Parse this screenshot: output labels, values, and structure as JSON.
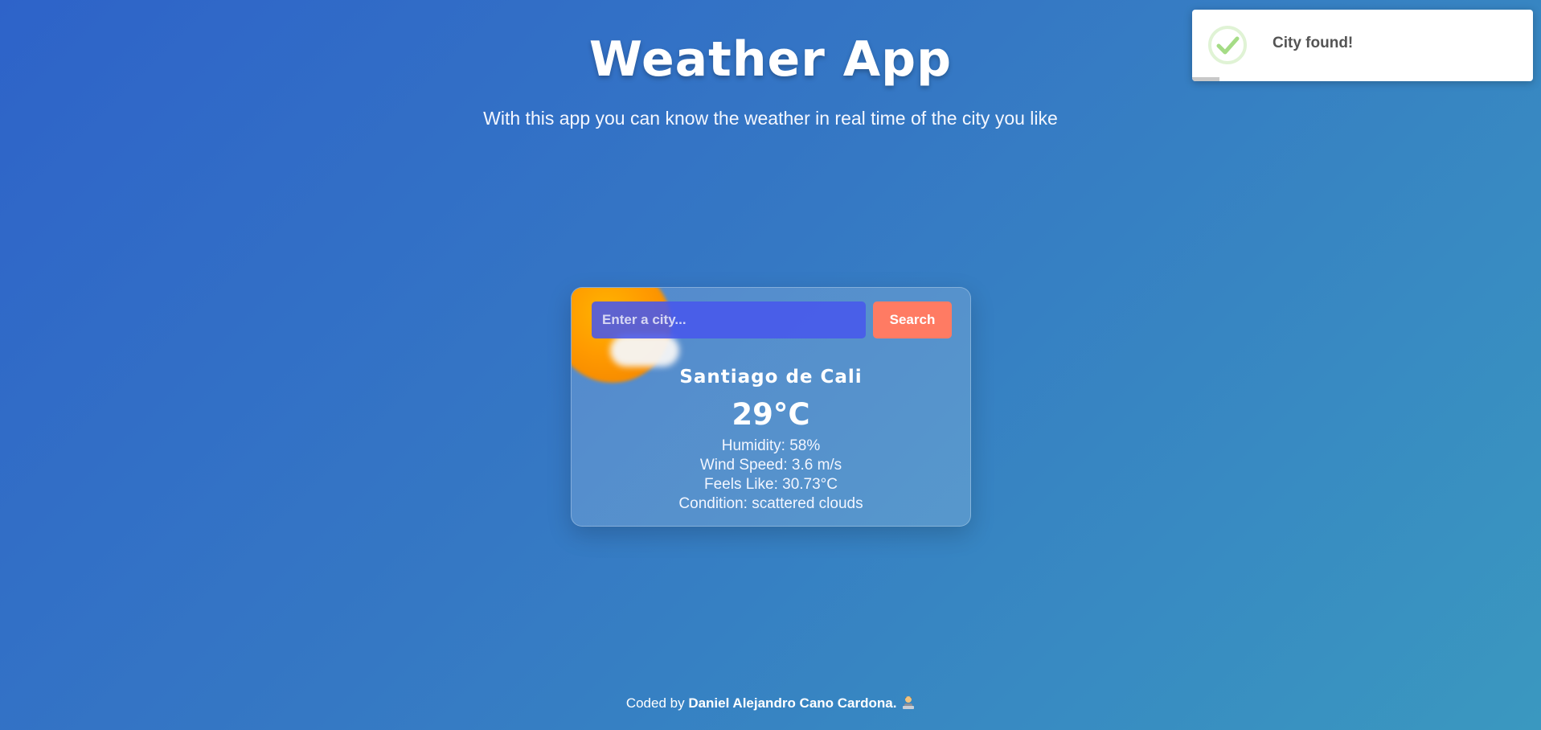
{
  "header": {
    "title": "Weather App",
    "subtitle": "With this app you can know the weather in real time of the city you like"
  },
  "search": {
    "placeholder": "Enter a city...",
    "value": "",
    "button_label": "Search"
  },
  "weather": {
    "city": "Santiago de Cali",
    "temperature": "29°C",
    "humidity": "Humidity: 58%",
    "wind_speed": "Wind Speed: 3.6 m/s",
    "feels_like": "Feels Like: 30.73°C",
    "condition": "Condition: scattered clouds",
    "icon": "sun-behind-cloud-icon"
  },
  "footer": {
    "prefix": "Coded by ",
    "author": "Daniel Alejandro Cano Cardona.",
    "icon": "technologist-emoji-icon"
  },
  "toast": {
    "message": "City found!",
    "icon": "success-check-icon",
    "progress_fraction": 0.08
  },
  "colors": {
    "search_button": "#ff7b63",
    "input_background": "#4858ec",
    "success": "#a5dc86"
  }
}
